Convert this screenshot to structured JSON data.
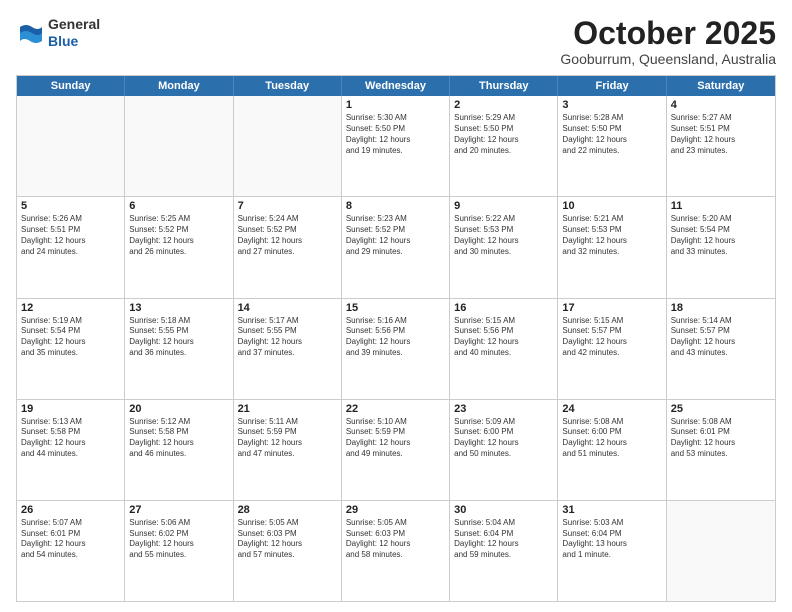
{
  "header": {
    "logo_line1": "General",
    "logo_line2": "Blue",
    "month": "October 2025",
    "location": "Gooburrum, Queensland, Australia"
  },
  "weekdays": [
    "Sunday",
    "Monday",
    "Tuesday",
    "Wednesday",
    "Thursday",
    "Friday",
    "Saturday"
  ],
  "rows": [
    [
      {
        "day": "",
        "info": ""
      },
      {
        "day": "",
        "info": ""
      },
      {
        "day": "",
        "info": ""
      },
      {
        "day": "1",
        "info": "Sunrise: 5:30 AM\nSunset: 5:50 PM\nDaylight: 12 hours\nand 19 minutes."
      },
      {
        "day": "2",
        "info": "Sunrise: 5:29 AM\nSunset: 5:50 PM\nDaylight: 12 hours\nand 20 minutes."
      },
      {
        "day": "3",
        "info": "Sunrise: 5:28 AM\nSunset: 5:50 PM\nDaylight: 12 hours\nand 22 minutes."
      },
      {
        "day": "4",
        "info": "Sunrise: 5:27 AM\nSunset: 5:51 PM\nDaylight: 12 hours\nand 23 minutes."
      }
    ],
    [
      {
        "day": "5",
        "info": "Sunrise: 5:26 AM\nSunset: 5:51 PM\nDaylight: 12 hours\nand 24 minutes."
      },
      {
        "day": "6",
        "info": "Sunrise: 5:25 AM\nSunset: 5:52 PM\nDaylight: 12 hours\nand 26 minutes."
      },
      {
        "day": "7",
        "info": "Sunrise: 5:24 AM\nSunset: 5:52 PM\nDaylight: 12 hours\nand 27 minutes."
      },
      {
        "day": "8",
        "info": "Sunrise: 5:23 AM\nSunset: 5:52 PM\nDaylight: 12 hours\nand 29 minutes."
      },
      {
        "day": "9",
        "info": "Sunrise: 5:22 AM\nSunset: 5:53 PM\nDaylight: 12 hours\nand 30 minutes."
      },
      {
        "day": "10",
        "info": "Sunrise: 5:21 AM\nSunset: 5:53 PM\nDaylight: 12 hours\nand 32 minutes."
      },
      {
        "day": "11",
        "info": "Sunrise: 5:20 AM\nSunset: 5:54 PM\nDaylight: 12 hours\nand 33 minutes."
      }
    ],
    [
      {
        "day": "12",
        "info": "Sunrise: 5:19 AM\nSunset: 5:54 PM\nDaylight: 12 hours\nand 35 minutes."
      },
      {
        "day": "13",
        "info": "Sunrise: 5:18 AM\nSunset: 5:55 PM\nDaylight: 12 hours\nand 36 minutes."
      },
      {
        "day": "14",
        "info": "Sunrise: 5:17 AM\nSunset: 5:55 PM\nDaylight: 12 hours\nand 37 minutes."
      },
      {
        "day": "15",
        "info": "Sunrise: 5:16 AM\nSunset: 5:56 PM\nDaylight: 12 hours\nand 39 minutes."
      },
      {
        "day": "16",
        "info": "Sunrise: 5:15 AM\nSunset: 5:56 PM\nDaylight: 12 hours\nand 40 minutes."
      },
      {
        "day": "17",
        "info": "Sunrise: 5:15 AM\nSunset: 5:57 PM\nDaylight: 12 hours\nand 42 minutes."
      },
      {
        "day": "18",
        "info": "Sunrise: 5:14 AM\nSunset: 5:57 PM\nDaylight: 12 hours\nand 43 minutes."
      }
    ],
    [
      {
        "day": "19",
        "info": "Sunrise: 5:13 AM\nSunset: 5:58 PM\nDaylight: 12 hours\nand 44 minutes."
      },
      {
        "day": "20",
        "info": "Sunrise: 5:12 AM\nSunset: 5:58 PM\nDaylight: 12 hours\nand 46 minutes."
      },
      {
        "day": "21",
        "info": "Sunrise: 5:11 AM\nSunset: 5:59 PM\nDaylight: 12 hours\nand 47 minutes."
      },
      {
        "day": "22",
        "info": "Sunrise: 5:10 AM\nSunset: 5:59 PM\nDaylight: 12 hours\nand 49 minutes."
      },
      {
        "day": "23",
        "info": "Sunrise: 5:09 AM\nSunset: 6:00 PM\nDaylight: 12 hours\nand 50 minutes."
      },
      {
        "day": "24",
        "info": "Sunrise: 5:08 AM\nSunset: 6:00 PM\nDaylight: 12 hours\nand 51 minutes."
      },
      {
        "day": "25",
        "info": "Sunrise: 5:08 AM\nSunset: 6:01 PM\nDaylight: 12 hours\nand 53 minutes."
      }
    ],
    [
      {
        "day": "26",
        "info": "Sunrise: 5:07 AM\nSunset: 6:01 PM\nDaylight: 12 hours\nand 54 minutes."
      },
      {
        "day": "27",
        "info": "Sunrise: 5:06 AM\nSunset: 6:02 PM\nDaylight: 12 hours\nand 55 minutes."
      },
      {
        "day": "28",
        "info": "Sunrise: 5:05 AM\nSunset: 6:03 PM\nDaylight: 12 hours\nand 57 minutes."
      },
      {
        "day": "29",
        "info": "Sunrise: 5:05 AM\nSunset: 6:03 PM\nDaylight: 12 hours\nand 58 minutes."
      },
      {
        "day": "30",
        "info": "Sunrise: 5:04 AM\nSunset: 6:04 PM\nDaylight: 12 hours\nand 59 minutes."
      },
      {
        "day": "31",
        "info": "Sunrise: 5:03 AM\nSunset: 6:04 PM\nDaylight: 13 hours\nand 1 minute."
      },
      {
        "day": "",
        "info": ""
      }
    ]
  ]
}
